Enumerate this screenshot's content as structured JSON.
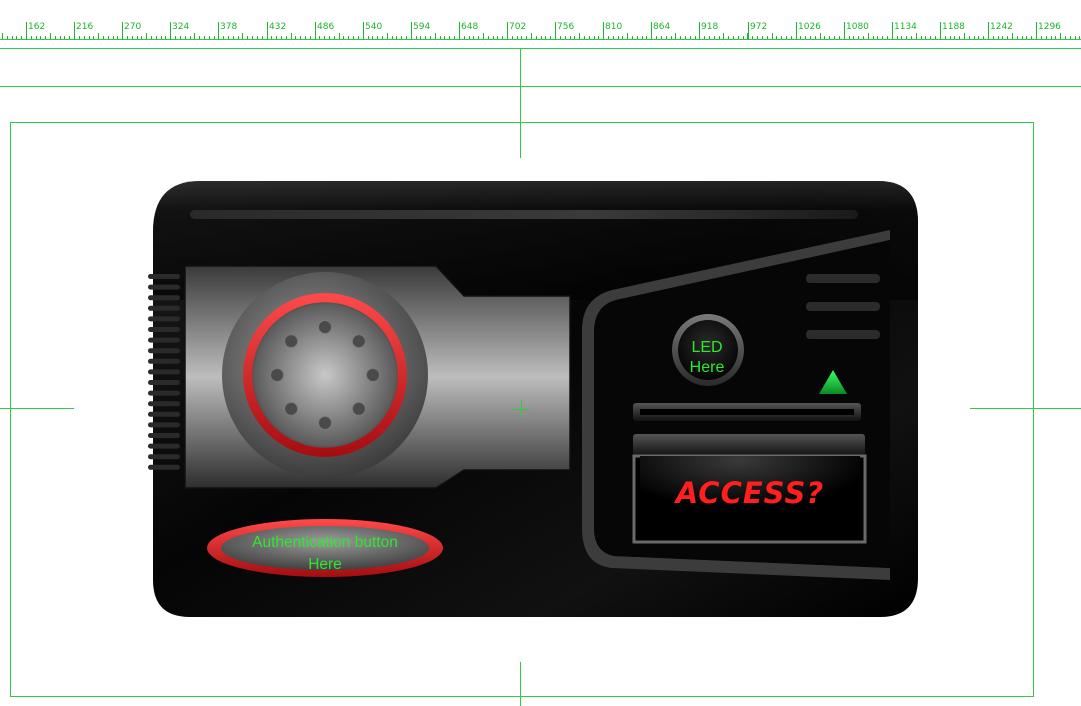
{
  "ruler": {
    "labels": [
      "162",
      "216",
      "270",
      "324",
      "378",
      "432",
      "486",
      "540",
      "594",
      "648",
      "702",
      "756",
      "810",
      "864",
      "918",
      "972",
      "1026",
      "1080",
      "1134",
      "1188",
      "1242",
      "1296"
    ]
  },
  "device": {
    "led_label": "LED\nHere",
    "led_line1": "LED",
    "led_line2": "Here",
    "auth_line1": "Authentication button",
    "auth_line2": "Here",
    "access_text": "ACCESS?"
  },
  "colors": {
    "guide": "#2ecc40",
    "accent_red": "#e0282a",
    "label_green": "#2ee82e",
    "indicator_green": "#19c43a",
    "body": "#0a0a0a"
  },
  "icons": [
    "fingerprint-sensor-icon",
    "led-indicator-icon",
    "up-arrow-icon"
  ]
}
